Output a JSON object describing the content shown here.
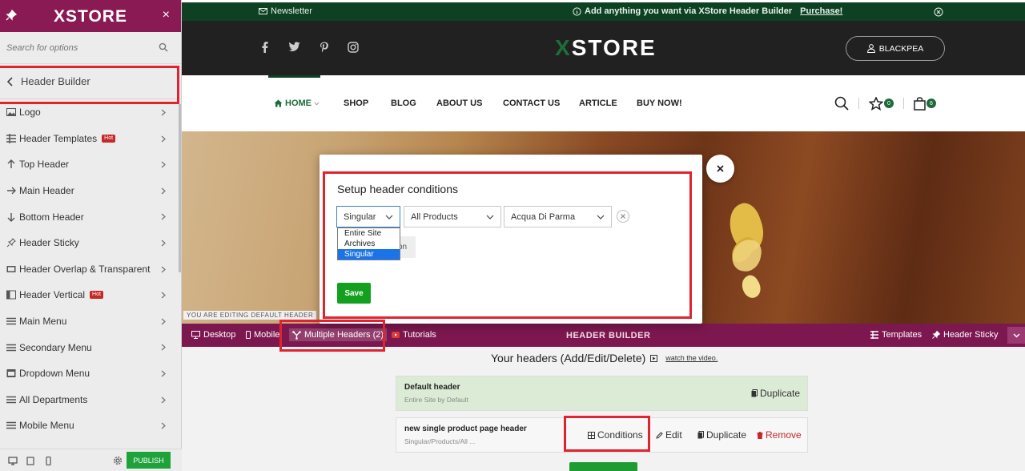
{
  "sidebar": {
    "logo": "XSTORE",
    "close_glyph": "×",
    "search_placeholder": "Search for options",
    "section_title": "Header Builder",
    "items": [
      {
        "label": "Logo",
        "icon": "image-icon",
        "hot": false
      },
      {
        "label": "Header Templates",
        "icon": "grid-icon",
        "hot": true
      },
      {
        "label": "Top Header",
        "icon": "arrow-up-icon",
        "hot": false
      },
      {
        "label": "Main Header",
        "icon": "arrow-right-icon",
        "hot": false
      },
      {
        "label": "Bottom Header",
        "icon": "arrow-down-icon",
        "hot": false
      },
      {
        "label": "Header Sticky",
        "icon": "pin-icon",
        "hot": false
      },
      {
        "label": "Header Overlap & Transparent",
        "icon": "layers-icon",
        "hot": false
      },
      {
        "label": "Header Vertical",
        "icon": "sidebar-icon",
        "hot": true
      },
      {
        "label": "Main Menu",
        "icon": "menu-icon",
        "hot": false
      },
      {
        "label": "Secondary Menu",
        "icon": "menu-icon",
        "hot": false
      },
      {
        "label": "Dropdown Menu",
        "icon": "dropdown-icon",
        "hot": false
      },
      {
        "label": "All Departments",
        "icon": "menu-icon",
        "hot": false
      },
      {
        "label": "Mobile Menu",
        "icon": "menu-icon",
        "hot": false
      }
    ],
    "hot_label": "Hot",
    "publish_label": "PUBLISH"
  },
  "topbar": {
    "newsletter": "Newsletter",
    "message": "Add anything you want via XStore Header Builder",
    "purchase": "Purchase!"
  },
  "masthead": {
    "logo_x": "X",
    "logo_rest": "STORE",
    "account": "BLACKPEA"
  },
  "nav": {
    "home": "HOME",
    "links": [
      "SHOP",
      "BLOG",
      "ABOUT US",
      "CONTACT US",
      "ARTICLE",
      "BUY NOW!"
    ],
    "wishlist_count": "0",
    "cart_count": "6"
  },
  "editing_label": "YOU ARE EDITING DEFAULT HEADER",
  "header_builder": {
    "desktop": "Desktop",
    "mobile": "Mobile",
    "multiple": "Multiple Headers (2)",
    "tutorials": "Tutorials",
    "title": "HEADER BUILDER",
    "templates": "Templates",
    "sticky": "Header Sticky",
    "your_headers": "Your headers (Add/Edit/Delete)",
    "watch": "watch the video.",
    "rows": [
      {
        "name": "Default header",
        "sub": "Entire Site by Default",
        "duplicate": "Duplicate"
      },
      {
        "name": "new single product page header",
        "sub": "Singular/Products/All ...",
        "conditions": "Conditions",
        "edit": "Edit",
        "duplicate": "Duplicate",
        "remove": "Remove"
      }
    ]
  },
  "modal": {
    "title": "Setup header conditions",
    "type_value": "Singular",
    "category_value": "All Products",
    "item_value": "Acqua Di Parma",
    "add_hint": "on",
    "options": [
      "Entire Site",
      "Archives",
      "Singular"
    ],
    "selected_option": "Singular",
    "save": "Save"
  },
  "colors": {
    "brand": "#8a1a53",
    "green": "#0e4023",
    "accent_green": "#1d6b3b",
    "highlight": "#e0242f"
  }
}
